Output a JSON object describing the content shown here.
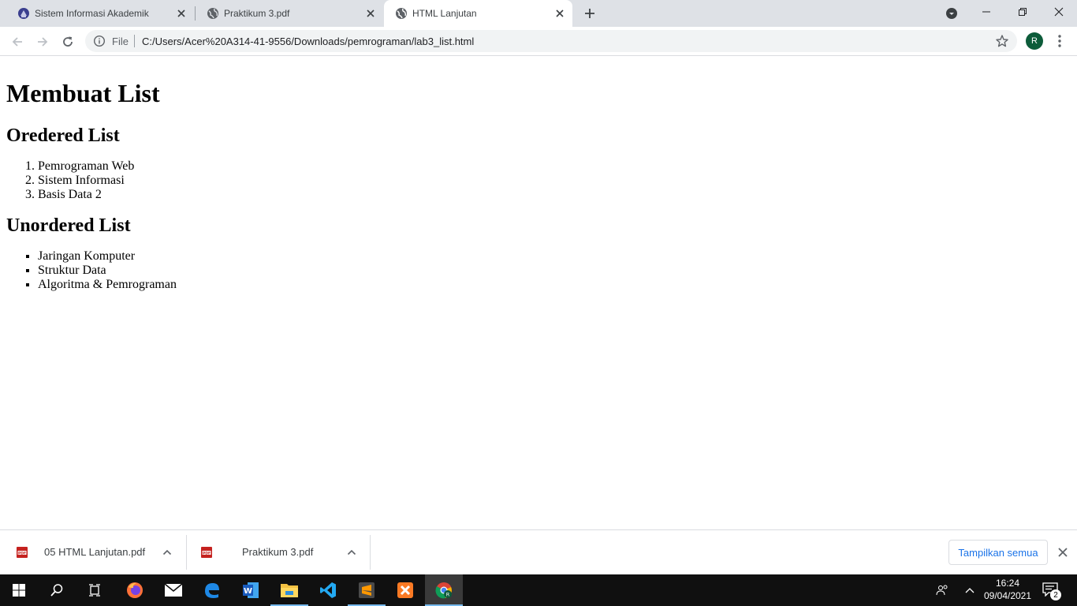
{
  "browser": {
    "tabs": [
      {
        "title": "Sistem Informasi Akademik",
        "active": false
      },
      {
        "title": "Praktikum 3.pdf",
        "active": false
      },
      {
        "title": "HTML Lanjutan",
        "active": true
      }
    ],
    "omnibox": {
      "chip": "File",
      "url": "C:/Users/Acer%20A314-41-9556/Downloads/pemrograman/lab3_list.html"
    },
    "profile_initial": "R",
    "profile_color": "#0d5c3a"
  },
  "page": {
    "title": "Membuat List",
    "ordered_heading": "Oredered List",
    "ordered_items": [
      "Pemrograman Web",
      "Sistem Informasi",
      "Basis Data 2"
    ],
    "unordered_heading": "Unordered List",
    "unordered_items": [
      "Jaringan Komputer",
      "Struktur Data",
      "Algoritma & Pemrograman"
    ]
  },
  "downloads": {
    "items": [
      {
        "name": "05 HTML Lanjutan.pdf",
        "icon": "pdf-icon"
      },
      {
        "name": "Praktikum 3.pdf",
        "icon": "pdf-icon"
      }
    ],
    "show_all": "Tampilkan semua"
  },
  "taskbar": {
    "time": "16:24",
    "date": "09/04/2021",
    "notification_count": "2",
    "apps": [
      "firefox-icon",
      "mail-icon",
      "edge-icon",
      "word-icon",
      "file-explorer-icon",
      "vscode-icon",
      "sublime-icon",
      "xampp-icon",
      "chrome-icon"
    ]
  },
  "colors": {
    "accent": "#1a73e8",
    "tabstrip": "#dee1e6",
    "taskbar": "#101010"
  }
}
